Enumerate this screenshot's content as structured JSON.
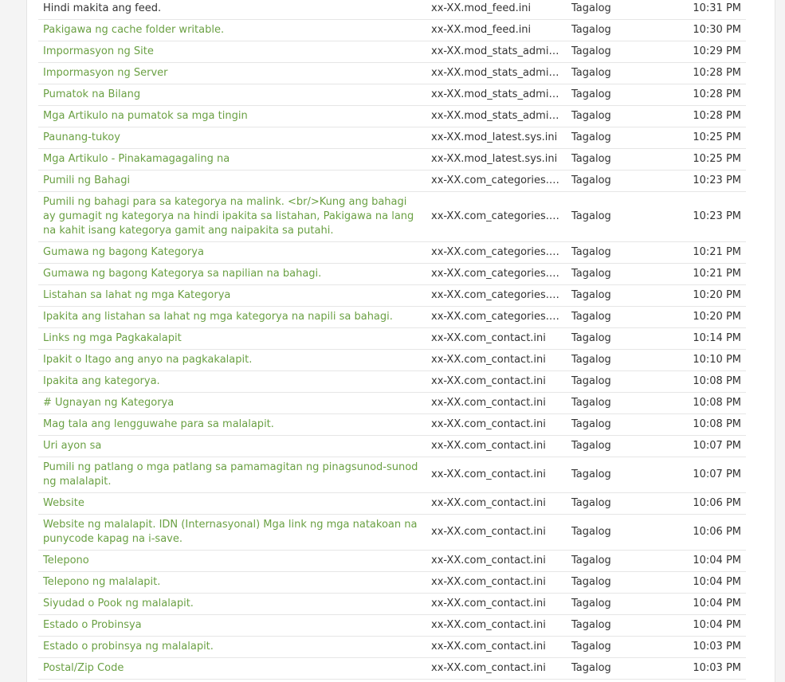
{
  "rows": [
    {
      "text": "Hindi makita ang feed.",
      "file": "xx-XX.mod_feed.ini",
      "lang": "Tagalog",
      "time": "10:31 PM",
      "link": false
    },
    {
      "text": "Pakigawa ng cache folder writable.",
      "file": "xx-XX.mod_feed.ini",
      "lang": "Tagalog",
      "time": "10:30 PM",
      "link": true
    },
    {
      "text": "Impormasyon ng Site",
      "file": "xx-XX.mod_stats_admin.ini",
      "lang": "Tagalog",
      "time": "10:29 PM",
      "link": true
    },
    {
      "text": "Impormasyon ng Server",
      "file": "xx-XX.mod_stats_admin.ini",
      "lang": "Tagalog",
      "time": "10:28 PM",
      "link": true
    },
    {
      "text": "Pumatok na Bilang",
      "file": "xx-XX.mod_stats_admin.ini",
      "lang": "Tagalog",
      "time": "10:28 PM",
      "link": true
    },
    {
      "text": "Mga Artikulo na pumatok sa mga tingin",
      "file": "xx-XX.mod_stats_admin.ini",
      "lang": "Tagalog",
      "time": "10:28 PM",
      "link": true
    },
    {
      "text": "Paunang-tukoy",
      "file": "xx-XX.mod_latest.sys.ini",
      "lang": "Tagalog",
      "time": "10:25 PM",
      "link": true
    },
    {
      "text": "Mga Artikulo - Pinakamagagaling na",
      "file": "xx-XX.mod_latest.sys.ini",
      "lang": "Tagalog",
      "time": "10:25 PM",
      "link": true
    },
    {
      "text": "Pumili ng Bahagi",
      "file": "xx-XX.com_categories.sys....",
      "lang": "Tagalog",
      "time": "10:23 PM",
      "link": true
    },
    {
      "text": "Pumili ng bahagi para sa kategorya na malink. <br/>Kung ang bahagi ay gumagit ng kategorya na hindi ipakita sa listahan, Pakigawa na lang na kahit isang kategorya gamit ang naipakita sa putahi.",
      "file": "xx-XX.com_categories.sys....",
      "lang": "Tagalog",
      "time": "10:23 PM",
      "link": true,
      "lines": 3
    },
    {
      "text": "Gumawa ng bagong Kategorya",
      "file": "xx-XX.com_categories.sys....",
      "lang": "Tagalog",
      "time": "10:21 PM",
      "link": true
    },
    {
      "text": "Gumawa ng bagong Kategorya sa napilian na bahagi.",
      "file": "xx-XX.com_categories.sys....",
      "lang": "Tagalog",
      "time": "10:21 PM",
      "link": true
    },
    {
      "text": "Listahan sa lahat ng mga Kategorya",
      "file": "xx-XX.com_categories.sys....",
      "lang": "Tagalog",
      "time": "10:20 PM",
      "link": true
    },
    {
      "text": "Ipakita ang listahan sa lahat ng mga kategorya na napili sa bahagi.",
      "file": "xx-XX.com_categories.sys....",
      "lang": "Tagalog",
      "time": "10:20 PM",
      "link": true
    },
    {
      "text": "Links ng mga Pagkakalapit",
      "file": "xx-XX.com_contact.ini",
      "lang": "Tagalog",
      "time": "10:14 PM",
      "link": true
    },
    {
      "text": "Ipakit o Itago ang anyo na pagkakalapit.",
      "file": "xx-XX.com_contact.ini",
      "lang": "Tagalog",
      "time": "10:10 PM",
      "link": true
    },
    {
      "text": "Ipakita ang kategorya.",
      "file": "xx-XX.com_contact.ini",
      "lang": "Tagalog",
      "time": "10:08 PM",
      "link": true
    },
    {
      "text": "# Ugnayan ng Kategorya",
      "file": "xx-XX.com_contact.ini",
      "lang": "Tagalog",
      "time": "10:08 PM",
      "link": true
    },
    {
      "text": "Mag tala ang lengguwahe para sa malalapit.",
      "file": "xx-XX.com_contact.ini",
      "lang": "Tagalog",
      "time": "10:08 PM",
      "link": true
    },
    {
      "text": "Uri ayon sa",
      "file": "xx-XX.com_contact.ini",
      "lang": "Tagalog",
      "time": "10:07 PM",
      "link": true
    },
    {
      "text": "Pumili ng patlang o mga patlang sa pamamagitan ng pinagsunod-sunod ng malalapit.",
      "file": "xx-XX.com_contact.ini",
      "lang": "Tagalog",
      "time": "10:07 PM",
      "link": true,
      "lines": 2
    },
    {
      "text": "Website",
      "file": "xx-XX.com_contact.ini",
      "lang": "Tagalog",
      "time": "10:06 PM",
      "link": true
    },
    {
      "text": "Website ng malalapit. IDN (Internasyonal) Mga link ng mga natakoan na punycode kapag na i-save.",
      "file": "xx-XX.com_contact.ini",
      "lang": "Tagalog",
      "time": "10:06 PM",
      "link": true,
      "lines": 2
    },
    {
      "text": "Telepono",
      "file": "xx-XX.com_contact.ini",
      "lang": "Tagalog",
      "time": "10:04 PM",
      "link": true
    },
    {
      "text": "Telepono ng malalapit.",
      "file": "xx-XX.com_contact.ini",
      "lang": "Tagalog",
      "time": "10:04 PM",
      "link": true
    },
    {
      "text": "Siyudad o Pook ng malalapit.",
      "file": "xx-XX.com_contact.ini",
      "lang": "Tagalog",
      "time": "10:04 PM",
      "link": true
    },
    {
      "text": "Estado o Probinsya",
      "file": "xx-XX.com_contact.ini",
      "lang": "Tagalog",
      "time": "10:04 PM",
      "link": true
    },
    {
      "text": "Estado o probinsya ng malalapit.",
      "file": "xx-XX.com_contact.ini",
      "lang": "Tagalog",
      "time": "10:03 PM",
      "link": true
    },
    {
      "text": "Postal/Zip Code",
      "file": "xx-XX.com_contact.ini",
      "lang": "Tagalog",
      "time": "10:03 PM",
      "link": true
    }
  ]
}
